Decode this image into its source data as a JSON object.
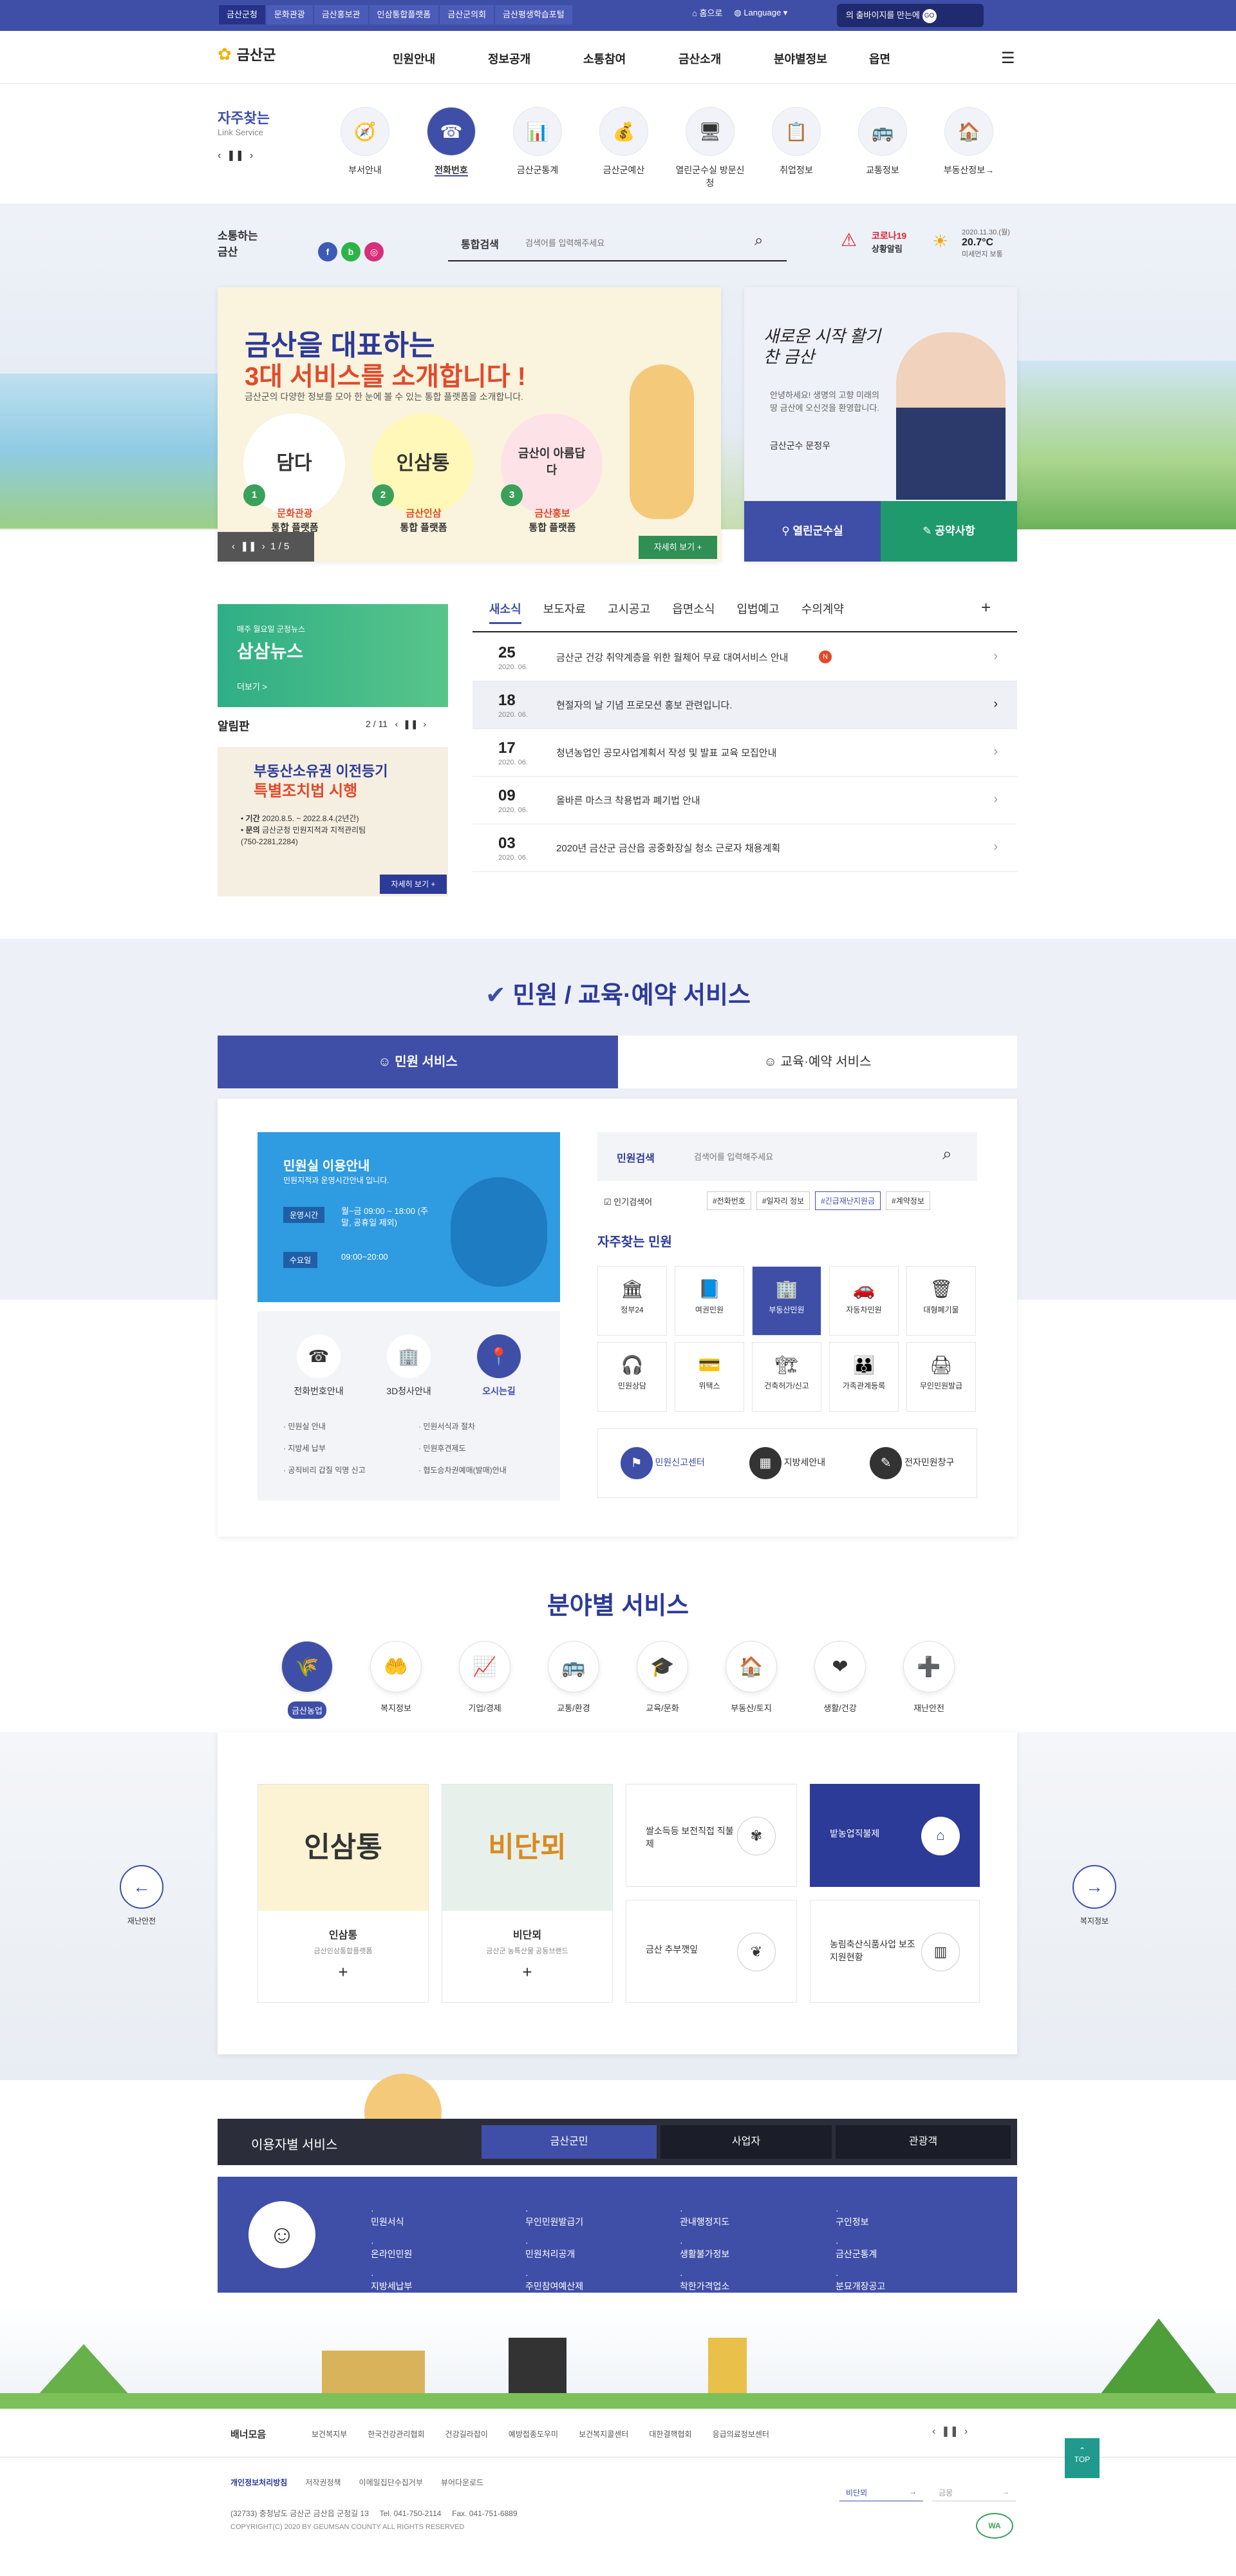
{
  "topbar": {
    "sites": [
      "금산군청",
      "문화관광",
      "금산홍보관",
      "인삼통합플랫폼",
      "금산군의회",
      "금산평생학습포털"
    ],
    "home": "홈으로",
    "language": "Language",
    "campaign": "의 출바이지를 만는에"
  },
  "header": {
    "logo": "금산군",
    "menu": [
      "민원안내",
      "정보공개",
      "소통참여",
      "금산소개",
      "분야별정보",
      "읍면"
    ]
  },
  "quicklinks": {
    "title": "자주찾는",
    "subtitle": "Link Service",
    "items": [
      {
        "label": "부서안내",
        "icon": "🧭"
      },
      {
        "label": "전화번호",
        "icon": "☎"
      },
      {
        "label": "금산군통계",
        "icon": "📊"
      },
      {
        "label": "금산군예산",
        "icon": "💰"
      },
      {
        "label": "열린군수실 방문신청",
        "icon": "🖥"
      },
      {
        "label": "취업정보",
        "icon": "📋"
      },
      {
        "label": "교통정보",
        "icon": "🚌"
      },
      {
        "label": "부동산정보→",
        "icon": "🏠"
      }
    ]
  },
  "social": {
    "label1": "소통하는",
    "label2": "금산",
    "search_label": "통합검색",
    "search_placeholder": "검색어를 입력해주세요",
    "covid": "코로나19",
    "covid_sub": "상황알림",
    "weather_date": "2020.11.30.(월)",
    "weather_temp": "20.7°C",
    "weather_dust": "미세먼지 보통"
  },
  "banner": {
    "line1": "금산을 대표하는",
    "line2": "3대 서비스를 소개합니다 !",
    "desc": "금산군의 다양한 정보를 모아 한 눈에 볼 수 있는 통합 플랫폼을 소개합니다.",
    "items": [
      {
        "num": "1",
        "logo": "담다",
        "name": "문화관광",
        "sub": "통합 플랫폼"
      },
      {
        "num": "2",
        "logo": "인삼통",
        "name": "금산인삼",
        "sub": "통합 플랫폼"
      },
      {
        "num": "3",
        "logo": "금산이 아름답다",
        "name": "금산홍보",
        "sub": "통합 플랫폼"
      }
    ],
    "page": "1 / 5",
    "more": "자세히 보기 +"
  },
  "mayor": {
    "slogan": "새로운 시작 활기찬 금산",
    "greeting": "안녕하세요! 생명의 고향 미래의 땅 금산에 오신것을 환영합니다.",
    "sign": "금산군수 문정우",
    "btn1": "열린군수실",
    "btn2": "공약사항"
  },
  "news": {
    "promo_top": "매주 월요일 군정뉴스",
    "promo_title": "삼삼뉴스",
    "promo_more": "더보기 >",
    "board_title": "알림판",
    "board_page": "2 / 11",
    "notice_line1": "부동산소유권 이전등기",
    "notice_line2": "특별조치법 시행",
    "notice_period_label": "기간",
    "notice_period": "2020.8.5. ~ 2022.8.4.(2년간)",
    "notice_ask_label": "문의",
    "notice_ask": "금산군청 민원지적과 지적관리팀 (750-2281,2284)",
    "notice_more": "자세히 보기 +",
    "tabs": [
      "새소식",
      "보도자료",
      "고시공고",
      "읍면소식",
      "입법예고",
      "수의계약"
    ],
    "rows": [
      {
        "d": "25",
        "m": "2020. 06.",
        "t": "금산군 건강 취약계층을 위한 월체어 무료 대여서비스 안내",
        "badge": "N"
      },
      {
        "d": "18",
        "m": "2020. 06.",
        "t": "현절자의 날 기념 프로모션 홍보 관련입니다."
      },
      {
        "d": "17",
        "m": "2020. 06.",
        "t": "청년농업인 공모사업계획서 작성 및 발표 교육 모집안내"
      },
      {
        "d": "09",
        "m": "2020. 06.",
        "t": "올바른 마스크 착용법과 폐기법 안내"
      },
      {
        "d": "03",
        "m": "2020. 06.",
        "t": "2020년 금산군 금산읍 공중화장실 청소 근로자 채용계획"
      }
    ]
  },
  "civil": {
    "heading": "민원 / 교육·예약 서비스",
    "tab1": "민원 서비스",
    "tab2": "교육·예약 서비스",
    "guide_title": "민원실 이용안내",
    "guide_desc": "민원지적과 운영시간안내 입니다.",
    "hours_label": "운영시간",
    "hours": "월~금 09:00 ~ 18:00 (주말, 공휴일 제외)",
    "wed_label": "수요일",
    "wed": "09:00~20:00",
    "links": [
      {
        "label": "전화번호안내",
        "icon": "☎"
      },
      {
        "label": "3D청사안내",
        "icon": "🏢"
      },
      {
        "label": "오시는길",
        "icon": "📍"
      }
    ],
    "sublist1": [
      "민원실 안내",
      "지방세 납부",
      "공직비리 갑질 익명 신고"
    ],
    "sublist2": [
      "민원서식과 절차",
      "민원후견제도",
      "협도승차권예매(발매)안내"
    ],
    "search_label": "민원검색",
    "search_placeholder": "검색어를 입력해주세요",
    "popular_label": "인기검색어",
    "tags": [
      "#전화번호",
      "#일자리 정보",
      "#긴급재난지원금",
      "#계약정보"
    ],
    "freq_title": "자주찾는 민원",
    "grid": [
      {
        "l": "정부24",
        "i": "🏛"
      },
      {
        "l": "여권민원",
        "i": "📘"
      },
      {
        "l": "부동산민원",
        "i": "🏢"
      },
      {
        "l": "자동차민원",
        "i": "🚗"
      },
      {
        "l": "대형폐기물",
        "i": "🗑"
      },
      {
        "l": "민원상담",
        "i": "🎧"
      },
      {
        "l": "위택스",
        "i": "💳"
      },
      {
        "l": "건축허가/신고",
        "i": "🏗"
      },
      {
        "l": "가족관계등록",
        "i": "👪"
      },
      {
        "l": "무인민원발급",
        "i": "🖨"
      }
    ],
    "bottom": [
      "민원신고센터",
      "지방세안내",
      "전자민원창구"
    ]
  },
  "field": {
    "heading": "분야별 서비스",
    "items": [
      {
        "l": "금산농업",
        "i": "🌾"
      },
      {
        "l": "복지정보",
        "i": "🤲"
      },
      {
        "l": "기업/경제",
        "i": "📈"
      },
      {
        "l": "교통/환경",
        "i": "🚌"
      },
      {
        "l": "교육/문화",
        "i": "🎓"
      },
      {
        "l": "부동산/토지",
        "i": "🏠"
      },
      {
        "l": "생활/건강",
        "i": "❤"
      },
      {
        "l": "재난안전",
        "i": "➕"
      }
    ],
    "prev": "재난안전",
    "next": "복지정보",
    "box1_logo": "인삼통",
    "box1_title": "인삼통",
    "box1_sub": "금산인삼통합플랫폼",
    "box2_logo": "비단뫼",
    "box2_title": "비단뫼",
    "box2_sub": "금산군 농특산물 공동브랜드",
    "box3": "쌀소득등 보전직접 직불제",
    "box4": "밭농업직불제",
    "box5": "금산 추부깻잎",
    "box6": "농림축산식품사업 보조지원현황"
  },
  "users": {
    "title": "이용자별 서비스",
    "tabs": [
      "금산군민",
      "사업자",
      "관광객"
    ],
    "col1": [
      "민원서식",
      "온라인민원",
      "지방세납부"
    ],
    "col2": [
      "무인민원발급기",
      "민원처리공개",
      "주민참여예산제"
    ],
    "col3": [
      "관내행정지도",
      "생활불가정보",
      "착한가격업소"
    ],
    "col4": [
      "구인정보",
      "금산군통계",
      "분묘개장공고"
    ]
  },
  "footer": {
    "banner_label": "배너모음",
    "banners": [
      "보건복지부",
      "한국건강관리협회",
      "건강길라잡이",
      "예방접종도우미",
      "보건복지콜센터",
      "대한결핵협회",
      "응급의료정보센터"
    ],
    "links": [
      "개인정보처리방침",
      "저작권정책",
      "이메일집단수집거부",
      "뷰어다운로드"
    ],
    "address": "(32733) 충청남도 금산군 금산읍 군청길 13",
    "tel": "Tel. 041-750-2114",
    "fax": "Fax. 041-751-6889",
    "copyright": "COPYRIGHT(C) 2020 BY GEUMSAN COUNTY ALL RIGHTS RESERVED",
    "select": "비단뫼",
    "select2": "금몽",
    "top": "TOP"
  }
}
